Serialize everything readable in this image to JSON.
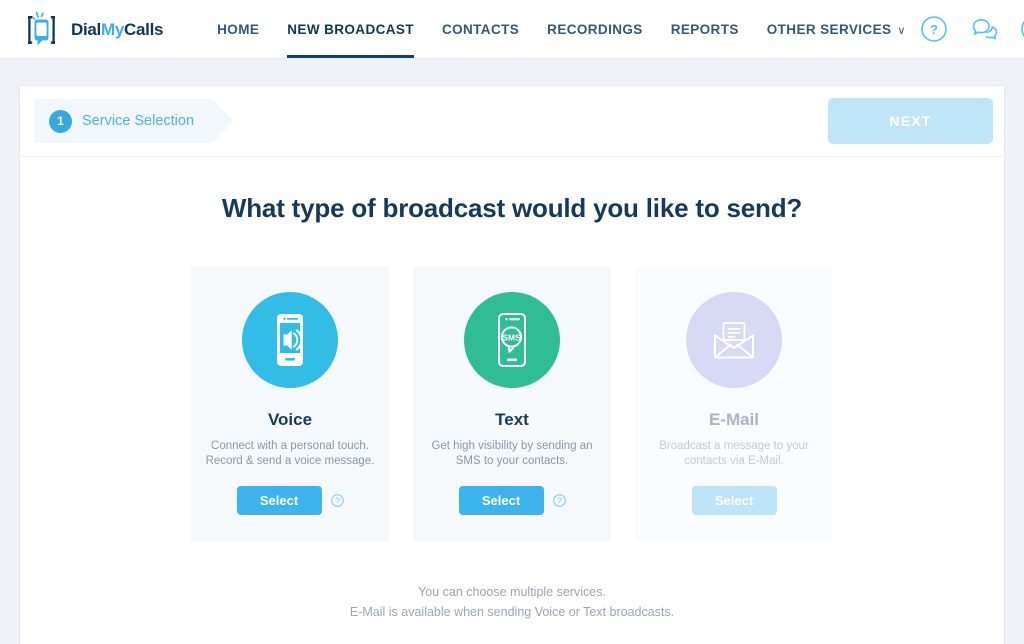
{
  "brand": {
    "logo_dial": "Dial",
    "logo_my": "My",
    "logo_calls": "Calls",
    "accent_blue": "#3cb3ec",
    "navy": "#153a5c"
  },
  "header": {
    "nav": [
      {
        "label": "HOME",
        "active": false
      },
      {
        "label": "NEW BROADCAST",
        "active": true
      },
      {
        "label": "CONTACTS",
        "active": false
      },
      {
        "label": "RECORDINGS",
        "active": false
      },
      {
        "label": "REPORTS",
        "active": false
      },
      {
        "label": "OTHER SERVICES",
        "active": false,
        "caret": "∨"
      }
    ],
    "actions": [
      {
        "icon": "help-circle-icon"
      },
      {
        "icon": "chat-bubbles-icon"
      },
      {
        "icon": "user-account-icon"
      }
    ]
  },
  "step_bar": {
    "step_number": "1",
    "step_label": "Service Selection",
    "next_label": "NEXT",
    "next_disabled": true
  },
  "main": {
    "headline": "What type of broadcast would you like to send?",
    "cards": [
      {
        "id": "voice",
        "title": "Voice",
        "desc_line1": "Connect with a personal touch.",
        "desc_line2": "Record & send a voice message.",
        "button_label": "Select",
        "icon": "phone-speaker-icon",
        "icon_color": "#31bde6",
        "disabled": false,
        "has_help": true
      },
      {
        "id": "text",
        "title": "Text",
        "desc_line1": "Get high visibility by sending an",
        "desc_line2": "SMS to your contacts.",
        "button_label": "Select",
        "icon": "phone-sms-icon",
        "icon_color": "#2fbd96",
        "disabled": false,
        "has_help": true
      },
      {
        "id": "email",
        "title": "E-Mail",
        "desc_line1": "Broadcast a message to your",
        "desc_line2": "contacts via E-Mail.",
        "button_label": "Select",
        "icon": "envelope-icon",
        "icon_color": "#d7d9f5",
        "disabled": true,
        "has_help": false
      }
    ],
    "footnote_line1": "You can choose multiple services.",
    "footnote_line2": "E-Mail is available when sending Voice or Text broadcasts."
  }
}
